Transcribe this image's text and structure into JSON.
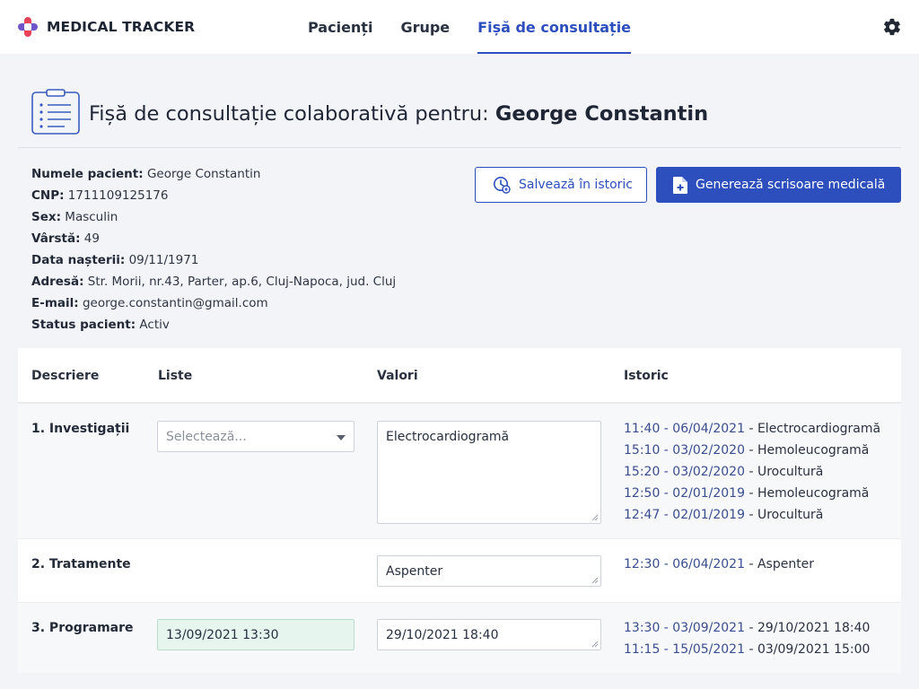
{
  "brand": {
    "name": "MEDICAL TRACKER"
  },
  "nav": {
    "tabs": [
      {
        "label": "Pacienți",
        "active": false
      },
      {
        "label": "Grupe",
        "active": false
      },
      {
        "label": "Fișă de consultație",
        "active": true
      }
    ]
  },
  "header": {
    "title_prefix": "Fișă de consultație colaborativă pentru: ",
    "patient_name": "George Constantin"
  },
  "patient": {
    "fields": [
      {
        "label": "Numele pacient:",
        "value": "George Constantin"
      },
      {
        "label": "CNP:",
        "value": "1711109125176"
      },
      {
        "label": "Sex:",
        "value": "Masculin"
      },
      {
        "label": "Vârstă:",
        "value": "49"
      },
      {
        "label": "Data nașterii:",
        "value": "09/11/1971"
      },
      {
        "label": "Adresă:",
        "value": "Str. Morii, nr.43, Parter, ap.6, Cluj-Napoca, jud. Cluj"
      },
      {
        "label": "E-mail:",
        "value": "george.constantin@gmail.com"
      },
      {
        "label": "Status pacient:",
        "value": "Activ"
      }
    ]
  },
  "actions": {
    "save_label": "Salvează în istoric",
    "generate_label": "Generează scrisoare medicală"
  },
  "table": {
    "headers": [
      "Descriere",
      "Liste",
      "Valori",
      "Istoric"
    ],
    "rows": [
      {
        "label": "1. Investigații",
        "select_placeholder": "Selectează...",
        "value": "Electrocardiogramă",
        "history": [
          {
            "ts": "11:40 - 06/04/2021",
            "text": " - Electrocardiogramă"
          },
          {
            "ts": "15:10 - 03/02/2020",
            "text": " - Hemoleucogramă"
          },
          {
            "ts": "15:20 - 03/02/2020",
            "text": " - Urocultură"
          },
          {
            "ts": "12:50 - 02/01/2019",
            "text": " - Hemoleucogramă"
          },
          {
            "ts": "12:47 - 02/01/2019",
            "text": " - Urocultură"
          }
        ]
      },
      {
        "label": "2. Tratamente",
        "value": "Aspenter",
        "history": [
          {
            "ts": "12:30 - 06/04/2021",
            "text": " - Aspenter"
          }
        ]
      },
      {
        "label": "3. Programare",
        "list_value": "13/09/2021 13:30",
        "value": "29/10/2021 18:40",
        "history": [
          {
            "ts": "13:30 - 03/09/2021",
            "text": " - 29/10/2021 18:40"
          },
          {
            "ts": "11:15 - 15/05/2021",
            "text": " - 03/09/2021 15:00"
          }
        ]
      }
    ]
  },
  "colors": {
    "accent": "#2d4fbd",
    "logo_red": "#e8425a",
    "logo_purple": "#6f55c9",
    "date_bg": "#e6f6ee"
  }
}
